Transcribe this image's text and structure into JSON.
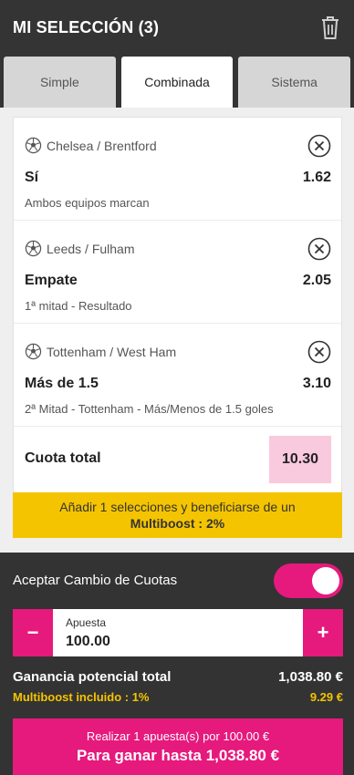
{
  "header": {
    "title": "MI SELECCIÓN (3)",
    "trash_icon": "trash-icon"
  },
  "tabs": [
    {
      "label": "Simple",
      "active": false
    },
    {
      "label": "Combinada",
      "active": true
    },
    {
      "label": "Sistema",
      "active": false
    }
  ],
  "selections": [
    {
      "match": "Chelsea / Brentford",
      "pick": "Sí",
      "odd": "1.62",
      "market": "Ambos equipos marcan"
    },
    {
      "match": "Leeds / Fulham",
      "pick": "Empate",
      "odd": "2.05",
      "market": "1ª mitad - Resultado"
    },
    {
      "match": "Tottenham / West Ham",
      "pick": "Más de 1.5",
      "odd": "3.10",
      "market": "2ª Mitad - Tottenham - Más/Menos de 1.5 goles"
    }
  ],
  "total": {
    "label": "Cuota total",
    "value": "10.30"
  },
  "promo": {
    "line1": "Añadir 1 selecciones y beneficiarse de un",
    "line2": "Multiboost : 2%"
  },
  "bottom": {
    "accept_label": "Aceptar Cambio de Cuotas",
    "accept_enabled": true,
    "stake": {
      "label": "Apuesta",
      "value": "100.00",
      "minus": "−",
      "plus": "+"
    },
    "gain_label": "Ganancia potencial total",
    "gain_value": "1,038.80 €",
    "multiboost_label": "Multiboost incluido : 1%",
    "multiboost_value": "9.29 €",
    "cta_line1": "Realizar 1 apuesta(s) por 100.00 €",
    "cta_line2": "Para ganar hasta 1,038.80 €"
  },
  "colors": {
    "accent": "#e6197d",
    "promo": "#f5c400",
    "dark": "#343434",
    "odd_highlight": "#f9c9de"
  }
}
